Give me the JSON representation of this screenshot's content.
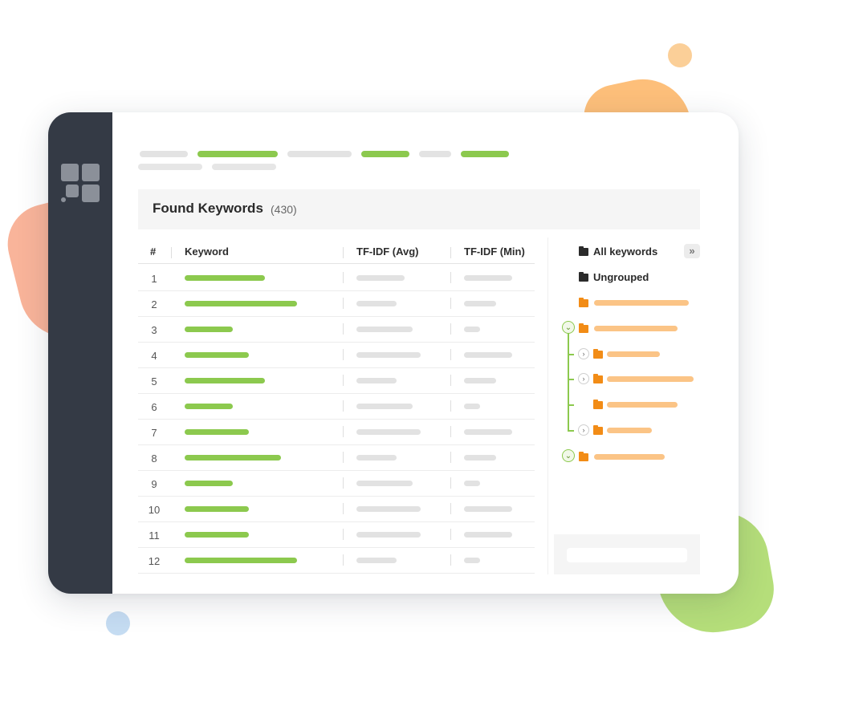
{
  "table": {
    "title": "Found Keywords",
    "count": "(430)",
    "columns": {
      "num": "#",
      "keyword": "Keyword",
      "tfidf_avg": "TF-IDF (Avg)",
      "tfidf_min": "TF-IDF (Min)"
    },
    "rows": [
      "1",
      "2",
      "3",
      "4",
      "5",
      "6",
      "7",
      "8",
      "9",
      "10",
      "11",
      "12"
    ]
  },
  "groups": {
    "all_keywords": "All keywords",
    "ungrouped": "Ungrouped",
    "collapse_icon": "double-chevron-right-icon"
  },
  "colors": {
    "sidebar": "#343a45",
    "accent_green": "#8cc94e",
    "folder_orange": "#f28c16",
    "placeholder_orange": "#fbc486",
    "placeholder_gray": "#e2e2e2"
  }
}
